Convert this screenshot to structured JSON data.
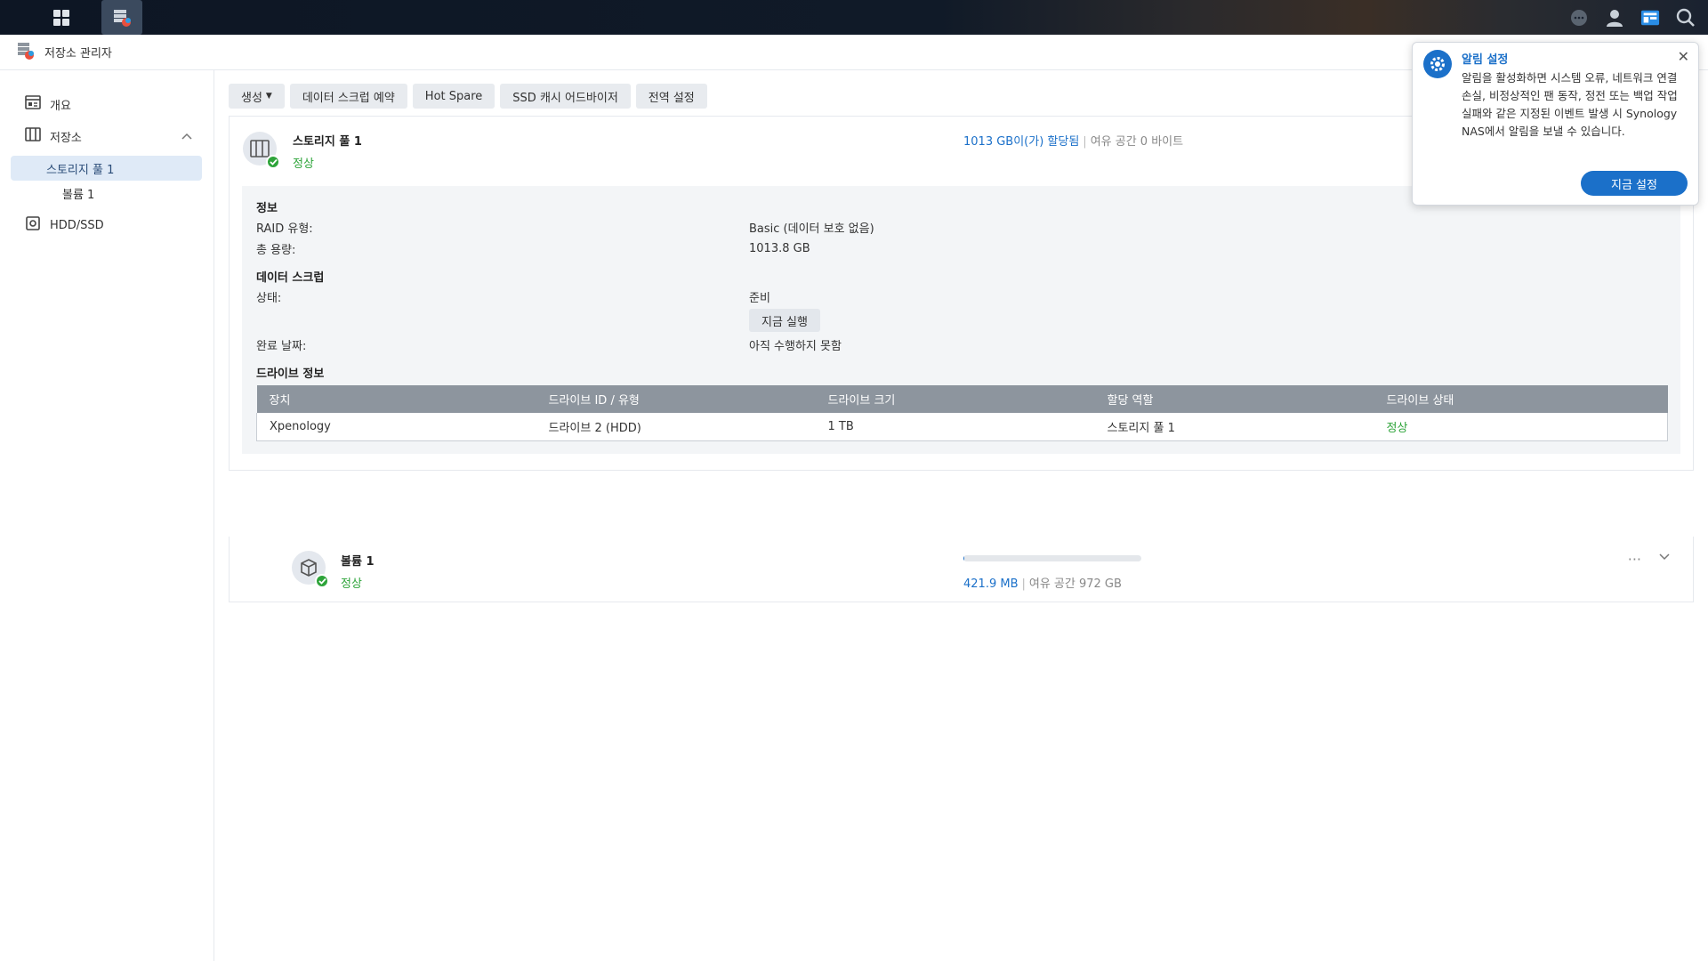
{
  "taskbar": {
    "icons": [
      "apps-grid-icon",
      "storage-manager-icon",
      "chat-icon",
      "user-icon",
      "widgets-icon",
      "search-icon"
    ]
  },
  "window": {
    "title": "저장소 관리자"
  },
  "sidebar": {
    "overview": "개요",
    "storage": "저장소",
    "pool": "스토리지 풀 1",
    "volume": "볼륨 1",
    "hdd": "HDD/SSD"
  },
  "toolbar": {
    "create": "생성",
    "scrub_schedule": "데이터 스크럽 예약",
    "hot_spare": "Hot Spare",
    "ssd_cache": "SSD 캐시 어드바이저",
    "global_settings": "전역 설정"
  },
  "pool": {
    "name": "스토리지 풀 1",
    "status": "정상",
    "allocated": "1013 GB이(가) 할당됨",
    "sep": "|",
    "free": "여유 공간 0 바이트",
    "info": {
      "title": "정보",
      "raid_label": "RAID 유형:",
      "raid_value": "Basic (데이터 보호 없음)",
      "capacity_label": "총 용량:",
      "capacity_value": "1013.8 GB"
    },
    "scrub": {
      "title": "데이터 스크럽",
      "status_label": "상태:",
      "status_value": "준비",
      "run_button": "지금 실행",
      "completed_label": "완료 날짜:",
      "completed_value": "아직 수행하지 못함"
    },
    "drives": {
      "title": "드라이브 정보",
      "columns": [
        "장치",
        "드라이브 ID / 유형",
        "드라이브 크기",
        "할당 역할",
        "드라이브 상태"
      ],
      "rows": [
        [
          "Xpenology",
          "드라이브 2 (HDD)",
          "1 TB",
          "스토리지 풀 1",
          "정상"
        ]
      ]
    }
  },
  "volume": {
    "name": "볼륨 1",
    "status": "정상",
    "used": "421.9 MB",
    "sep": "|",
    "free": "여유 공간 972 GB",
    "usage_fraction": 0.005,
    "more": "···"
  },
  "popup": {
    "title": "알림 설정",
    "body": "알림을 활성화하면 시스템 오류, 네트워크 연결 손실, 비정상적인 팬 동작, 정전 또는 백업 작업 실패와 같은 지정된 이벤트 발생 시 Synology NAS에서 알림을 보낼 수 있습니다.",
    "button": "지금 설정",
    "close": "✕"
  },
  "colors": {
    "accent": "#1b70c9",
    "ok": "#2ea43a"
  }
}
